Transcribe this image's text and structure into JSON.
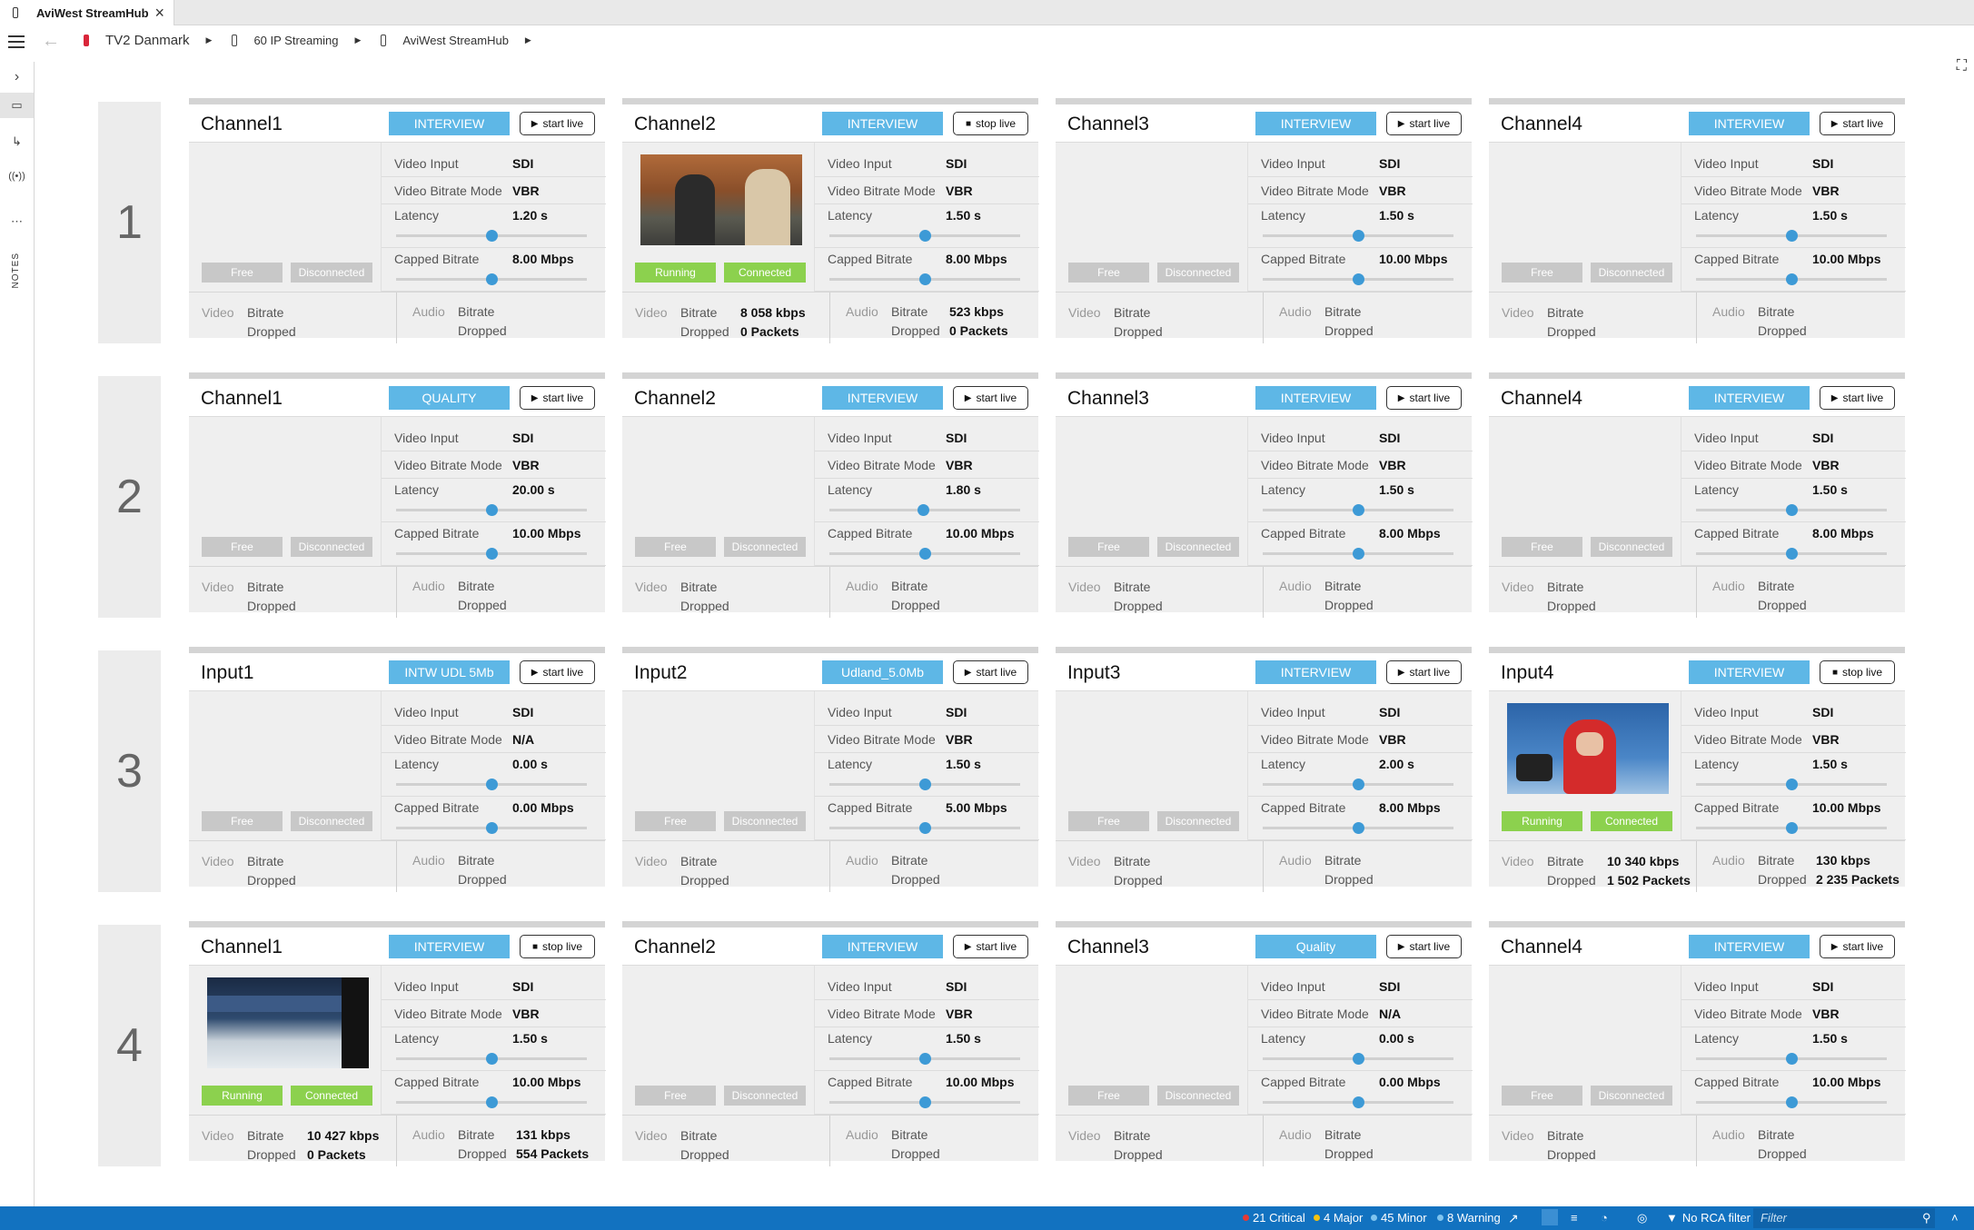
{
  "window": {
    "tab_title": "AviWest StreamHub",
    "close": "×"
  },
  "breadcrumb": [
    "TV2 Danmark",
    "60 IP Streaming",
    "AviWest StreamHub"
  ],
  "rail": {
    "notes": "NOTES"
  },
  "labels": {
    "video_input": "Video Input",
    "bitrate_mode": "Video Bitrate Mode",
    "latency": "Latency",
    "capped": "Capped Bitrate",
    "video": "Video",
    "audio": "Audio",
    "bitrate": "Bitrate",
    "dropped": "Dropped"
  },
  "rows": [
    "1",
    "2",
    "3",
    "4"
  ],
  "cards": [
    {
      "title": "Channel1",
      "profile": "INTERVIEW",
      "live": "start live",
      "video_input": "SDI",
      "mode": "VBR",
      "latency": "1.20 s",
      "latency_pos": 0.5,
      "capped": "8.00 Mbps",
      "capped_pos": 0.5,
      "s1": "Free",
      "s2": "Disconnected",
      "thumb": "",
      "vbit": "",
      "vdrop": "",
      "abit": "",
      "adrop": ""
    },
    {
      "title": "Channel2",
      "profile": "INTERVIEW",
      "live": "stop live",
      "video_input": "SDI",
      "mode": "VBR",
      "latency": "1.50 s",
      "latency_pos": 0.5,
      "capped": "8.00 Mbps",
      "capped_pos": 0.5,
      "s1": "Running",
      "s2": "Connected",
      "thumb": "interview",
      "vbit": "8 058 kbps",
      "vdrop": "0 Packets",
      "abit": "523 kbps",
      "adrop": "0 Packets"
    },
    {
      "title": "Channel3",
      "profile": "INTERVIEW",
      "live": "start live",
      "video_input": "SDI",
      "mode": "VBR",
      "latency": "1.50 s",
      "latency_pos": 0.5,
      "capped": "10.00 Mbps",
      "capped_pos": 0.5,
      "s1": "Free",
      "s2": "Disconnected",
      "thumb": "",
      "vbit": "",
      "vdrop": "",
      "abit": "",
      "adrop": ""
    },
    {
      "title": "Channel4",
      "profile": "INTERVIEW",
      "live": "start live",
      "video_input": "SDI",
      "mode": "VBR",
      "latency": "1.50 s",
      "latency_pos": 0.5,
      "capped": "10.00 Mbps",
      "capped_pos": 0.5,
      "s1": "Free",
      "s2": "Disconnected",
      "thumb": "",
      "vbit": "",
      "vdrop": "",
      "abit": "",
      "adrop": ""
    },
    {
      "title": "Channel1",
      "profile": "QUALITY",
      "live": "start live",
      "video_input": "SDI",
      "mode": "VBR",
      "latency": "20.00 s",
      "latency_pos": 0.5,
      "capped": "10.00 Mbps",
      "capped_pos": 0.5,
      "s1": "Free",
      "s2": "Disconnected",
      "thumb": "",
      "vbit": "",
      "vdrop": "",
      "abit": "",
      "adrop": ""
    },
    {
      "title": "Channel2",
      "profile": "INTERVIEW",
      "live": "start live",
      "video_input": "SDI",
      "mode": "VBR",
      "latency": "1.80 s",
      "latency_pos": 0.49,
      "capped": "10.00 Mbps",
      "capped_pos": 0.5,
      "s1": "Free",
      "s2": "Disconnected",
      "thumb": "",
      "vbit": "",
      "vdrop": "",
      "abit": "",
      "adrop": ""
    },
    {
      "title": "Channel3",
      "profile": "INTERVIEW",
      "live": "start live",
      "video_input": "SDI",
      "mode": "VBR",
      "latency": "1.50 s",
      "latency_pos": 0.5,
      "capped": "8.00 Mbps",
      "capped_pos": 0.5,
      "s1": "Free",
      "s2": "Disconnected",
      "thumb": "",
      "vbit": "",
      "vdrop": "",
      "abit": "",
      "adrop": ""
    },
    {
      "title": "Channel4",
      "profile": "INTERVIEW",
      "live": "start live",
      "video_input": "SDI",
      "mode": "VBR",
      "latency": "1.50 s",
      "latency_pos": 0.5,
      "capped": "8.00 Mbps",
      "capped_pos": 0.5,
      "s1": "Free",
      "s2": "Disconnected",
      "thumb": "",
      "vbit": "",
      "vdrop": "",
      "abit": "",
      "adrop": ""
    },
    {
      "title": "Input1",
      "profile": "INTW UDL 5Mb",
      "live": "start live",
      "video_input": "SDI",
      "mode": "N/A",
      "latency": "0.00 s",
      "latency_pos": 0.5,
      "capped": "0.00 Mbps",
      "capped_pos": 0.5,
      "s1": "Free",
      "s2": "Disconnected",
      "thumb": "",
      "vbit": "",
      "vdrop": "",
      "abit": "",
      "adrop": ""
    },
    {
      "title": "Input2",
      "profile": "Udland_5.0Mb",
      "live": "start live",
      "video_input": "SDI",
      "mode": "VBR",
      "latency": "1.50 s",
      "latency_pos": 0.5,
      "capped": "5.00 Mbps",
      "capped_pos": 0.5,
      "s1": "Free",
      "s2": "Disconnected",
      "thumb": "",
      "vbit": "",
      "vdrop": "",
      "abit": "",
      "adrop": ""
    },
    {
      "title": "Input3",
      "profile": "INTERVIEW",
      "live": "start live",
      "video_input": "SDI",
      "mode": "VBR",
      "latency": "2.00 s",
      "latency_pos": 0.5,
      "capped": "8.00 Mbps",
      "capped_pos": 0.5,
      "s1": "Free",
      "s2": "Disconnected",
      "thumb": "",
      "vbit": "",
      "vdrop": "",
      "abit": "",
      "adrop": ""
    },
    {
      "title": "Input4",
      "profile": "INTERVIEW",
      "live": "stop live",
      "video_input": "SDI",
      "mode": "VBR",
      "latency": "1.50 s",
      "latency_pos": 0.5,
      "capped": "10.00 Mbps",
      "capped_pos": 0.5,
      "s1": "Running",
      "s2": "Connected",
      "thumb": "hockey",
      "vbit": "10 340 kbps",
      "vdrop": "1 502 Packets",
      "abit": "130 kbps",
      "adrop": "2 235 Packets"
    },
    {
      "title": "Channel1",
      "profile": "INTERVIEW",
      "live": "stop live",
      "video_input": "SDI",
      "mode": "VBR",
      "latency": "1.50 s",
      "latency_pos": 0.5,
      "capped": "10.00 Mbps",
      "capped_pos": 0.5,
      "s1": "Running",
      "s2": "Connected",
      "thumb": "arena",
      "vbit": "10 427 kbps",
      "vdrop": "0 Packets",
      "abit": "131 kbps",
      "adrop": "554 Packets"
    },
    {
      "title": "Channel2",
      "profile": "INTERVIEW",
      "live": "start live",
      "video_input": "SDI",
      "mode": "VBR",
      "latency": "1.50 s",
      "latency_pos": 0.5,
      "capped": "10.00 Mbps",
      "capped_pos": 0.5,
      "s1": "Free",
      "s2": "Disconnected",
      "thumb": "",
      "vbit": "",
      "vdrop": "",
      "abit": "",
      "adrop": ""
    },
    {
      "title": "Channel3",
      "profile": "Quality",
      "live": "start live",
      "video_input": "SDI",
      "mode": "N/A",
      "latency": "0.00 s",
      "latency_pos": 0.5,
      "capped": "0.00 Mbps",
      "capped_pos": 0.5,
      "s1": "Free",
      "s2": "Disconnected",
      "thumb": "",
      "vbit": "",
      "vdrop": "",
      "abit": "",
      "adrop": ""
    },
    {
      "title": "Channel4",
      "profile": "INTERVIEW",
      "live": "start live",
      "video_input": "SDI",
      "mode": "VBR",
      "latency": "1.50 s",
      "latency_pos": 0.5,
      "capped": "10.00 Mbps",
      "capped_pos": 0.5,
      "s1": "Free",
      "s2": "Disconnected",
      "thumb": "",
      "vbit": "",
      "vdrop": "",
      "abit": "",
      "adrop": ""
    }
  ],
  "status": {
    "critical": "21 Critical",
    "major": "4 Major",
    "minor": "45 Minor",
    "warning": "8 Warning",
    "rca": "No RCA filter",
    "filter_placeholder": "Filter",
    "colors": {
      "critical": "#e53935",
      "major": "#f4c20d",
      "minor": "#7fc4ef",
      "warning": "#7fc4ef"
    }
  }
}
